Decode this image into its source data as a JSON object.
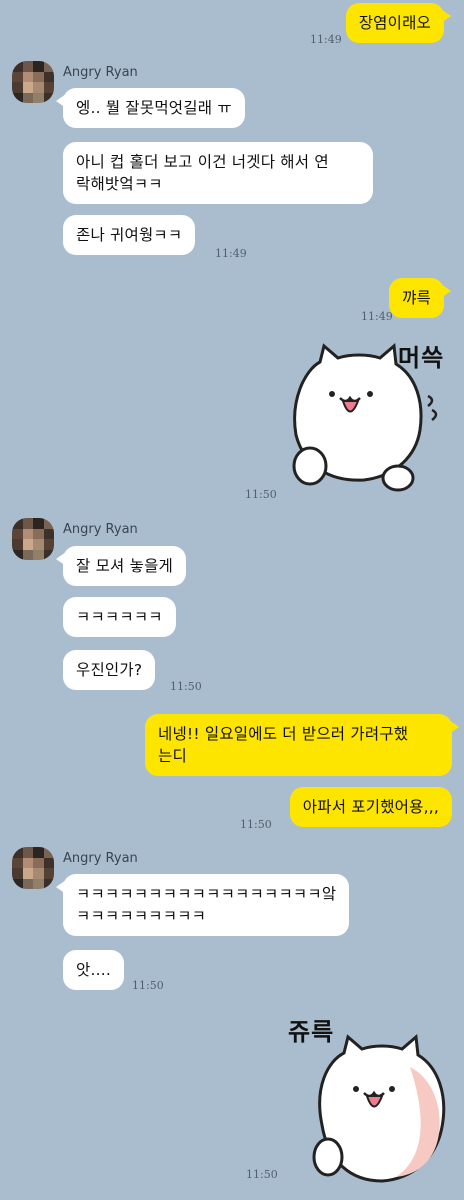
{
  "contact": {
    "name": "Angry Ryan"
  },
  "messages": {
    "m1": {
      "text": "장염이래오",
      "time": "11:49"
    },
    "m2": {
      "text": "엥.. 뭘 잘못먹엇길래 ㅠ"
    },
    "m3": {
      "text": "아니 컵 홀더 보고 이건 너겟다 해서 연\n락해밧엌ㅋㅋ"
    },
    "m4": {
      "text": "존나 귀여웡ㅋㅋ",
      "time": "11:49"
    },
    "m5": {
      "text": "꺄륵",
      "time": "11:49"
    },
    "m6": {
      "sticker_label": "머쓱",
      "time": "11:50"
    },
    "m7": {
      "text": "잘 모셔 놓을게"
    },
    "m8": {
      "text": "ㅋㅋㅋㅋㅋㅋ"
    },
    "m9": {
      "text": "우진인가?",
      "time": "11:50"
    },
    "m10": {
      "text": "네넹!! 일요일에도 더 받으러 가려구했\n는디"
    },
    "m11": {
      "text": "아파서 포기했어용,,,",
      "time": "11:50"
    },
    "m12": {
      "text": "ㅋㅋㅋㅋㅋㅋㅋㅋㅋㅋㅋㅋㅋㅋㅋㅋㅋ앜\nㅋㅋㅋㅋㅋㅋㅋㅋㅋ"
    },
    "m13": {
      "text": "앗....",
      "time": "11:50"
    },
    "m14": {
      "sticker_label": "쥬륵",
      "time": "11:50"
    }
  },
  "colors": {
    "background": "#a9bdce",
    "incoming_bubble": "#ffffff",
    "outgoing_bubble": "#fee500"
  },
  "icons": {
    "avatar": "pixelated-profile-photo",
    "sticker1": "white-cat-sticker-awkward",
    "sticker2": "white-cat-sticker-teary"
  }
}
